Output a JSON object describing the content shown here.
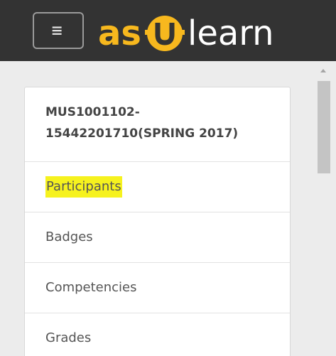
{
  "header": {
    "menu_toggle_icon": "hamburger-menu-icon",
    "logo": {
      "text_left": "as",
      "text_right": "learn",
      "mark_glyph": "U",
      "brand_color": "#f7b81e",
      "background_color": "#333333"
    }
  },
  "course_block": {
    "title": "MUS1001102-15442201710(SPRING 2017)",
    "title_line1": "MUS1001102-",
    "title_line2": "15442201710(SPRING 2017)",
    "items": [
      {
        "label": "Participants",
        "highlighted": true
      },
      {
        "label": "Badges"
      },
      {
        "label": "Competencies"
      },
      {
        "label": "Grades"
      }
    ]
  },
  "colors": {
    "highlight": "#f6f21e",
    "page_background": "#ececec",
    "text": "#555555"
  }
}
